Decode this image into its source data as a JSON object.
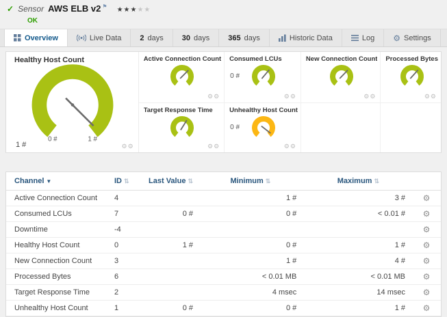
{
  "header": {
    "kind": "Sensor",
    "title": "AWS ELB v2",
    "status": "OK",
    "stars_filled": "★★★",
    "stars_empty": "★★"
  },
  "icons": {
    "check": "✓",
    "flag": "⚑",
    "gear": "⚙",
    "sort": "⇅",
    "sort_down": "▼",
    "overview": "grid",
    "live_data": "broadcast",
    "historic": "bar-chart",
    "log": "list",
    "settings": "gear"
  },
  "tabs": {
    "overview": {
      "label": "Overview"
    },
    "live": {
      "label": "Live Data"
    },
    "d2": {
      "num": "2",
      "label": "days"
    },
    "d30": {
      "num": "30",
      "label": "days"
    },
    "d365": {
      "num": "365",
      "label": "days"
    },
    "historic": {
      "label": "Historic Data"
    },
    "log": {
      "label": "Log"
    },
    "settings": {
      "label": "Settings"
    }
  },
  "gauges": {
    "main": {
      "title": "Healthy Host Count",
      "value": "1 #",
      "scale_min": "0 #",
      "scale_max": "1 #"
    },
    "cells": [
      {
        "title": "Active Connection Count",
        "value": ""
      },
      {
        "title": "Consumed LCUs",
        "value": "0 #"
      },
      {
        "title": "New Connection Count",
        "value": ""
      },
      {
        "title": "Processed Bytes",
        "value": ""
      },
      {
        "title": "Target Response Time",
        "value": ""
      },
      {
        "title": "Unhealthy Host Count",
        "value": "0 #"
      }
    ],
    "colors": {
      "ok": "#a9c114",
      "warning": "#fcb714",
      "needle": "#6b6b6b"
    }
  },
  "table": {
    "headers": {
      "channel": "Channel",
      "id": "ID",
      "last": "Last Value",
      "min": "Minimum",
      "max": "Maximum"
    },
    "rows": [
      {
        "channel": "Active Connection Count",
        "id": "4",
        "last": "",
        "min": "1 #",
        "max": "3 #"
      },
      {
        "channel": "Consumed LCUs",
        "id": "7",
        "last": "0 #",
        "min": "0 #",
        "max": "< 0.01 #"
      },
      {
        "channel": "Downtime",
        "id": "-4",
        "last": "",
        "min": "",
        "max": ""
      },
      {
        "channel": "Healthy Host Count",
        "id": "0",
        "last": "1 #",
        "min": "0 #",
        "max": "1 #"
      },
      {
        "channel": "New Connection Count",
        "id": "3",
        "last": "",
        "min": "1 #",
        "max": "4 #"
      },
      {
        "channel": "Processed Bytes",
        "id": "6",
        "last": "",
        "min": "< 0.01 MB",
        "max": "< 0.01 MB"
      },
      {
        "channel": "Target Response Time",
        "id": "2",
        "last": "",
        "min": "4 msec",
        "max": "14 msec"
      },
      {
        "channel": "Unhealthy Host Count",
        "id": "1",
        "last": "0 #",
        "min": "0 #",
        "max": "1 #"
      }
    ]
  }
}
